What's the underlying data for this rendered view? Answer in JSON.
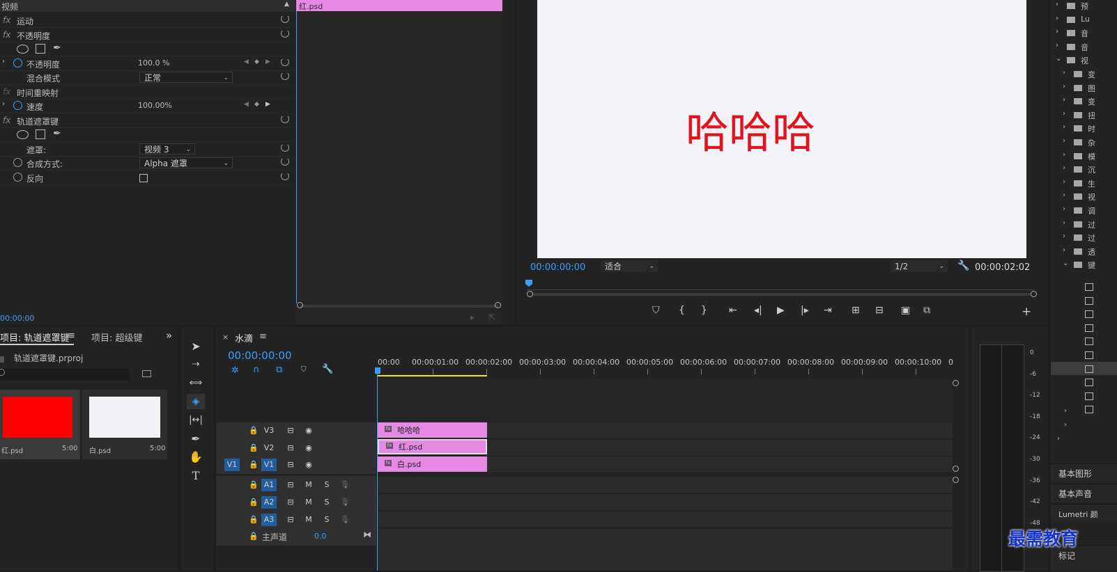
{
  "effect_controls": {
    "section_label": "视频",
    "clip_tab": "红.psd",
    "rows": {
      "motion": "运动",
      "opacity": "不透明度",
      "opacity_param": "不透明度",
      "opacity_value": "100.0 %",
      "blend_mode": "混合模式",
      "blend_value": "正常",
      "time_remap": "时间重映射",
      "speed": "速度",
      "speed_value": "100.00%",
      "track_matte": "轨道遮罩键",
      "matte": "遮罩:",
      "matte_value": "视频 3",
      "composite": "合成方式:",
      "composite_value": "Alpha 遮罩",
      "reverse": "反向"
    },
    "fx_symbol": "fx",
    "timecode": "00:00:00"
  },
  "program_monitor": {
    "canvas_text": "哈哈哈",
    "timecode_left": "00:00:00:00",
    "fit_label": "适合",
    "quality": "1/2",
    "timecode_right": "00:00:02:02",
    "add_label": "+"
  },
  "project_panel": {
    "tab_active": "项目: 轨道遮罩键",
    "tab_menu": "≡",
    "tab_other": "项目: 超级键",
    "more": "»",
    "file_name": "轨道遮罩键.prproj",
    "items": [
      {
        "name": "红.psd",
        "duration": "5:00",
        "color": "#ff0000"
      },
      {
        "name": "白.psd",
        "duration": "5:00",
        "color": "#f2f2f6"
      }
    ]
  },
  "timeline": {
    "close": "×",
    "sequence_name": "水滴",
    "menu": "≡",
    "timecode": "00:00:00:00",
    "ruler": [
      "00:00",
      "00:00:01:00",
      "00:00:02:00",
      "00:00:03:00",
      "00:00:04:00",
      "00:00:05:00",
      "00:00:06:00",
      "00:00:07:00",
      "00:00:08:00",
      "00:00:09:00",
      "00:00:10:00",
      "0"
    ],
    "video_tracks": [
      "V3",
      "V2",
      "V1"
    ],
    "source_patch": "V1",
    "audio_tracks": [
      "A1",
      "A2",
      "A3"
    ],
    "mute": "M",
    "solo": "S",
    "master": "主声道",
    "master_value": "0.0",
    "clips": [
      {
        "name": "哈哈哈",
        "fx": "fx"
      },
      {
        "name": "红.psd",
        "fx": "fx"
      },
      {
        "name": "白.psd",
        "fx": "fx"
      }
    ]
  },
  "right_panel": {
    "tree": [
      "预",
      "Lu",
      "音",
      "音",
      "视",
      "变",
      "图",
      "变",
      "扭",
      "时",
      "杂",
      "模",
      "沉",
      "生",
      "视",
      "调",
      "过",
      "过",
      "透",
      "键"
    ],
    "sections": [
      "基本图形",
      "基本声音",
      "Lumetri 颜",
      "标记"
    ]
  },
  "meters": [
    "0",
    "-6",
    "-12",
    "-18",
    "-24",
    "-30",
    "-36",
    "-42",
    "-48"
  ],
  "watermark": "最需教育",
  "colors": {
    "accent_blue": "#3aa0ff",
    "clip_pink": "#e589e5",
    "red_text": "#e0141e",
    "canvas": "#f4f4f8"
  }
}
